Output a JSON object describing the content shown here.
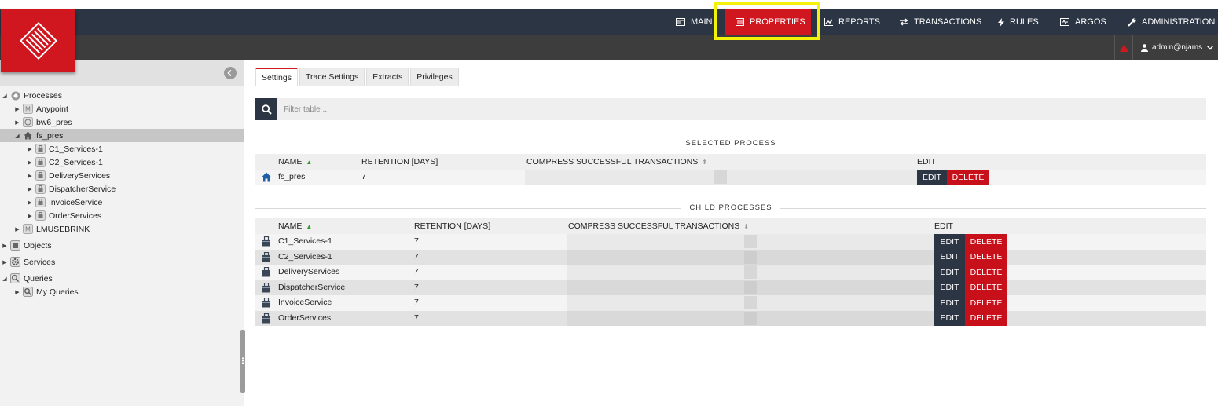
{
  "nav": {
    "items": [
      {
        "label": "MAIN",
        "icon": "main-icon"
      },
      {
        "label": "PROPERTIES",
        "icon": "properties-icon"
      },
      {
        "label": "REPORTS",
        "icon": "reports-icon"
      },
      {
        "label": "TRANSACTIONS",
        "icon": "transactions-icon"
      },
      {
        "label": "RULES",
        "icon": "rules-icon"
      },
      {
        "label": "ARGOS",
        "icon": "argos-icon"
      },
      {
        "label": "ADMINISTRATION",
        "icon": "administration-icon"
      }
    ],
    "active": "PROPERTIES",
    "user": "admin@njams"
  },
  "colors": {
    "brand": "#d0161f",
    "nav_bg": "#2b3544",
    "highlight": "#f2f20a"
  },
  "tree": {
    "processes": "Processes",
    "anypoint": "Anypoint",
    "bw6_pres": "bw6_pres",
    "fs_pres": "fs_pres",
    "children": [
      "C1_Services-1",
      "C2_Services-1",
      "DeliveryServices",
      "DispatcherService",
      "InvoiceService",
      "OrderServices"
    ],
    "lmusebrink": "LMUSEBRINK",
    "objects": "Objects",
    "services": "Services",
    "queries": "Queries",
    "my_queries": "My Queries"
  },
  "tabs": [
    "Settings",
    "Trace Settings",
    "Extracts",
    "Privileges"
  ],
  "search": {
    "placeholder": "Filter table ..."
  },
  "selected": {
    "title": "SELECTED PROCESS",
    "headers": {
      "name": "NAME",
      "retention": "RETENTION [DAYS]",
      "compress": "COMPRESS SUCCESSFUL TRANSACTIONS",
      "edit": "EDIT"
    },
    "row": {
      "name": "fs_pres",
      "retention": "7"
    }
  },
  "child": {
    "title": "CHILD PROCESSES",
    "headers": {
      "name": "NAME",
      "retention": "RETENTION [DAYS]",
      "compress": "COMPRESS SUCCESSFUL TRANSACTIONS",
      "edit": "EDIT"
    },
    "rows": [
      {
        "name": "C1_Services-1",
        "retention": "7"
      },
      {
        "name": "C2_Services-1",
        "retention": "7"
      },
      {
        "name": "DeliveryServices",
        "retention": "7"
      },
      {
        "name": "DispatcherService",
        "retention": "7"
      },
      {
        "name": "InvoiceService",
        "retention": "7"
      },
      {
        "name": "OrderServices",
        "retention": "7"
      }
    ]
  },
  "buttons": {
    "edit": "EDIT",
    "delete": "DELETE"
  }
}
